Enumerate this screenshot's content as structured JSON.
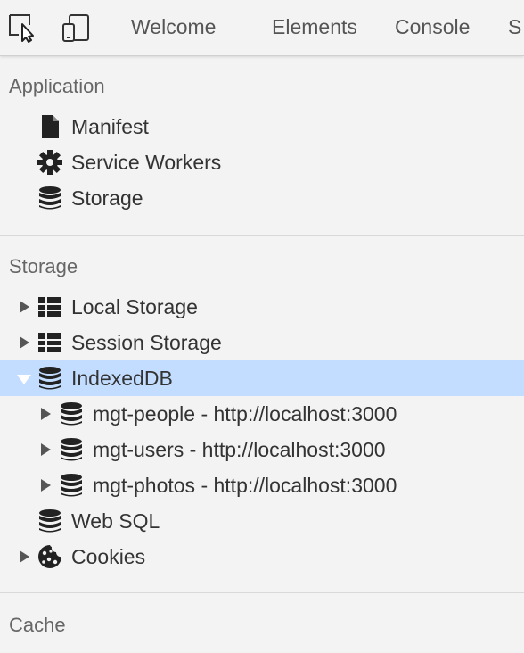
{
  "toolbar": {
    "tabs": [
      {
        "label": "Welcome"
      },
      {
        "label": "Elements"
      },
      {
        "label": "Console"
      },
      {
        "label": "S"
      }
    ]
  },
  "application": {
    "title": "Application",
    "items": [
      {
        "label": "Manifest",
        "icon": "file-icon"
      },
      {
        "label": "Service Workers",
        "icon": "gear-icon"
      },
      {
        "label": "Storage",
        "icon": "database-icon"
      }
    ]
  },
  "storage": {
    "title": "Storage",
    "local_storage": "Local Storage",
    "session_storage": "Session Storage",
    "indexeddb": "IndexedDB",
    "databases": [
      {
        "label": "mgt-people - http://localhost:3000"
      },
      {
        "label": "mgt-users - http://localhost:3000"
      },
      {
        "label": "mgt-photos - http://localhost:3000"
      }
    ],
    "web_sql": "Web SQL",
    "cookies": "Cookies"
  },
  "cache": {
    "title": "Cache"
  },
  "colors": {
    "selected_row": "#c2ddff",
    "panel_background": "#f3f3f3"
  }
}
